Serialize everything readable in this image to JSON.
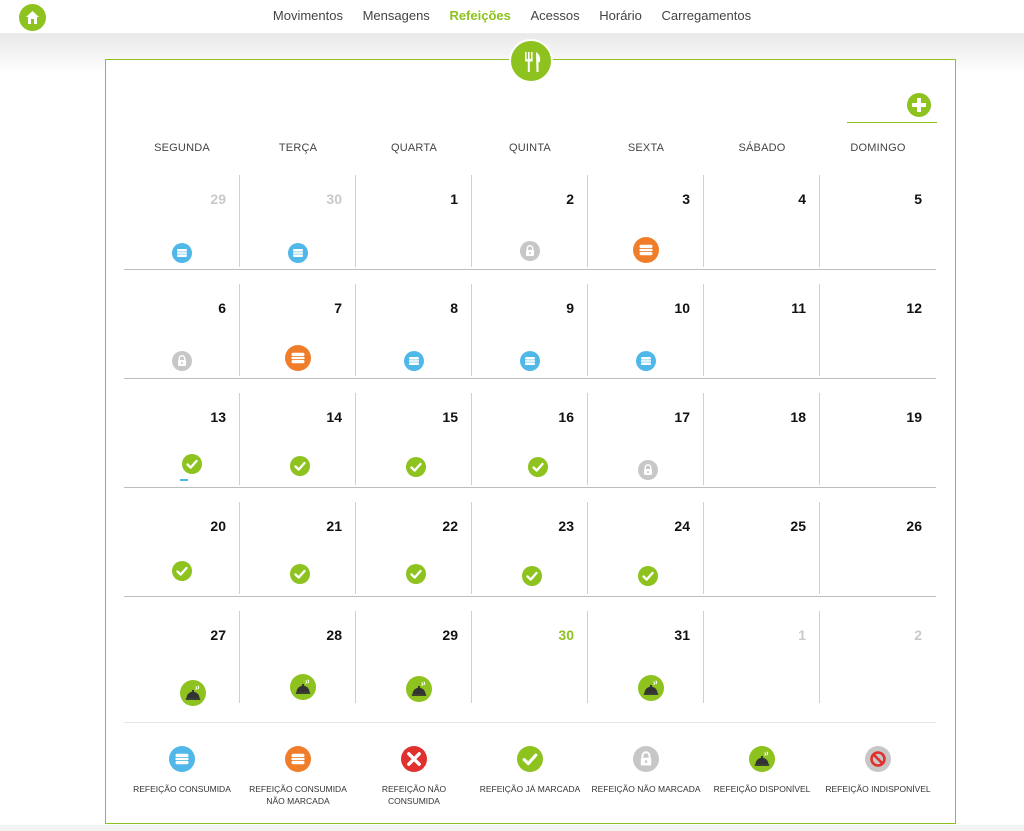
{
  "nav": {
    "items": [
      {
        "label": "Movimentos",
        "active": false
      },
      {
        "label": "Mensagens",
        "active": false
      },
      {
        "label": "Refeições",
        "active": true
      },
      {
        "label": "Acessos",
        "active": false
      },
      {
        "label": "Horário",
        "active": false
      },
      {
        "label": "Carregamentos",
        "active": false
      }
    ]
  },
  "colors": {
    "accent": "#8dc21f",
    "consumed": "#4fb8e8",
    "consumed_not_marked": "#f07d2a",
    "not_consumed": "#e0312f",
    "not_marked": "#c7c7c7"
  },
  "weekdays": [
    "SEGUNDA",
    "TERÇA",
    "QUARTA",
    "QUINTA",
    "SEXTA",
    "SÁBADO",
    "DOMINGO"
  ],
  "weeks": [
    [
      {
        "day": "29",
        "state": "muted",
        "icon": "consumed"
      },
      {
        "day": "30",
        "state": "muted",
        "icon": "consumed"
      },
      {
        "day": "1",
        "state": "normal",
        "icon": ""
      },
      {
        "day": "2",
        "state": "normal",
        "icon": "not-marked"
      },
      {
        "day": "3",
        "state": "normal",
        "icon": "consumed-not-marked"
      },
      {
        "day": "4",
        "state": "normal",
        "icon": ""
      },
      {
        "day": "5",
        "state": "normal",
        "icon": ""
      }
    ],
    [
      {
        "day": "6",
        "state": "normal",
        "icon": "not-marked"
      },
      {
        "day": "7",
        "state": "normal",
        "icon": "consumed-not-marked"
      },
      {
        "day": "8",
        "state": "normal",
        "icon": "consumed"
      },
      {
        "day": "9",
        "state": "normal",
        "icon": "consumed"
      },
      {
        "day": "10",
        "state": "normal",
        "icon": "consumed"
      },
      {
        "day": "11",
        "state": "normal",
        "icon": ""
      },
      {
        "day": "12",
        "state": "normal",
        "icon": ""
      }
    ],
    [
      {
        "day": "13",
        "state": "normal",
        "icon": "marked"
      },
      {
        "day": "14",
        "state": "normal",
        "icon": "marked"
      },
      {
        "day": "15",
        "state": "normal",
        "icon": "marked"
      },
      {
        "day": "16",
        "state": "normal",
        "icon": "marked"
      },
      {
        "day": "17",
        "state": "normal",
        "icon": "not-marked"
      },
      {
        "day": "18",
        "state": "normal",
        "icon": ""
      },
      {
        "day": "19",
        "state": "normal",
        "icon": ""
      }
    ],
    [
      {
        "day": "20",
        "state": "normal",
        "icon": "marked"
      },
      {
        "day": "21",
        "state": "normal",
        "icon": "marked"
      },
      {
        "day": "22",
        "state": "normal",
        "icon": "marked"
      },
      {
        "day": "23",
        "state": "normal",
        "icon": "marked"
      },
      {
        "day": "24",
        "state": "normal",
        "icon": "marked"
      },
      {
        "day": "25",
        "state": "normal",
        "icon": ""
      },
      {
        "day": "26",
        "state": "normal",
        "icon": ""
      }
    ],
    [
      {
        "day": "27",
        "state": "normal",
        "icon": "available"
      },
      {
        "day": "28",
        "state": "normal",
        "icon": "available"
      },
      {
        "day": "29",
        "state": "normal",
        "icon": "available"
      },
      {
        "day": "30",
        "state": "today",
        "icon": ""
      },
      {
        "day": "31",
        "state": "normal",
        "icon": "available"
      },
      {
        "day": "1",
        "state": "muted",
        "icon": ""
      },
      {
        "day": "2",
        "state": "muted",
        "icon": ""
      }
    ]
  ],
  "legend": [
    {
      "icon": "consumed",
      "label": "REFEIÇÃO CONSUMIDA"
    },
    {
      "icon": "consumed-not-marked",
      "label": "REFEIÇÃO CONSUMIDA NÃO MARCADA"
    },
    {
      "icon": "not-consumed",
      "label": "REFEIÇÃO NÃO CONSUMIDA"
    },
    {
      "icon": "marked",
      "label": "REFEIÇÃO JÁ MARCADA"
    },
    {
      "icon": "not-marked",
      "label": "REFEIÇÃO NÃO MARCADA"
    },
    {
      "icon": "available",
      "label": "REFEIÇÃO DISPONÍVEL"
    },
    {
      "icon": "unavailable",
      "label": "REFEIÇÃO INDISPONÍVEL"
    }
  ]
}
